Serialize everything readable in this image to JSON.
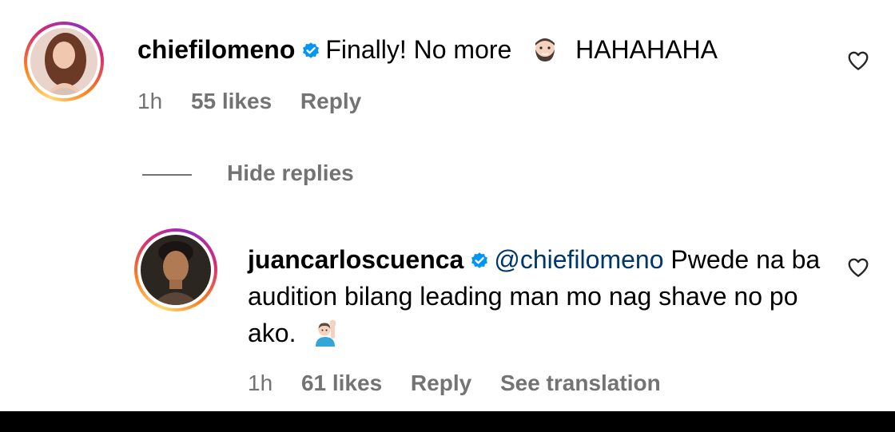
{
  "comment": {
    "username": "chiefilomeno",
    "text_before_emoji": "Finally! No more",
    "emoji_icon": "bearded-face-emoji",
    "text_after_emoji": "HAHAHAHA",
    "time": "1h",
    "likes": "55 likes",
    "reply_label": "Reply"
  },
  "replies_toggle": {
    "label": "Hide replies"
  },
  "reply": {
    "username": "juancarloscuenca",
    "mention": "@chiefilomeno",
    "text": "Pwede na ba audition bilang leading man mo nag shave no po ako.",
    "emoji_icon": "man-raising-hand-emoji",
    "time": "1h",
    "likes": "61 likes",
    "reply_label": "Reply",
    "translate_label": "See translation"
  },
  "colors": {
    "verified": "#0095f6",
    "secondary_text": "#737373",
    "mention": "#00376b"
  }
}
